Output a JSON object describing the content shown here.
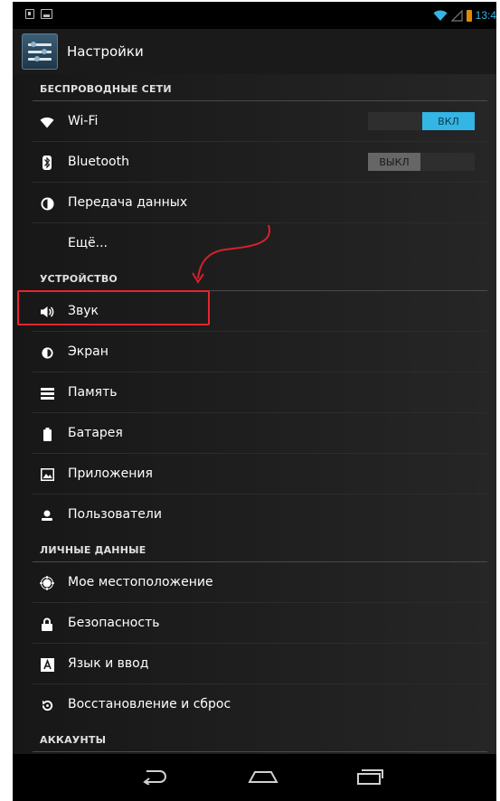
{
  "status_bar": {
    "time": "13:4",
    "icons": [
      "sim-card-icon",
      "image-icon",
      "wifi-signal-icon",
      "cell-signal-icon",
      "battery-icon"
    ],
    "time_color": "#33b5e5"
  },
  "action_bar": {
    "title": "Настройки",
    "icon": "settings-sliders-icon"
  },
  "sections": [
    {
      "header": "БЕСПРОВОДНЫЕ СЕТИ",
      "items": [
        {
          "label": "Wi-Fi",
          "icon": "wifi-icon",
          "toggle": "ВКЛ",
          "toggle_state": "on"
        },
        {
          "label": "Bluetooth",
          "icon": "bluetooth-icon",
          "toggle": "ВЫКЛ",
          "toggle_state": "off"
        },
        {
          "label": "Передача данных",
          "icon": "data-usage-icon"
        },
        {
          "label": "Ещё..."
        }
      ]
    },
    {
      "header": "УСТРОЙСТВО",
      "items": [
        {
          "label": "Звук",
          "icon": "speaker-icon",
          "highlighted": true
        },
        {
          "label": "Экран",
          "icon": "brightness-icon"
        },
        {
          "label": "Память",
          "icon": "storage-icon"
        },
        {
          "label": "Батарея",
          "icon": "battery-icon"
        },
        {
          "label": "Приложения",
          "icon": "apps-icon"
        },
        {
          "label": "Пользователи",
          "icon": "user-icon"
        }
      ]
    },
    {
      "header": "ЛИЧНЫЕ ДАННЫЕ",
      "items": [
        {
          "label": "Мое местоположение",
          "icon": "location-icon"
        },
        {
          "label": "Безопасность",
          "icon": "lock-icon"
        },
        {
          "label": "Язык и ввод",
          "icon": "language-icon"
        },
        {
          "label": "Восстановление и сброс",
          "icon": "restore-icon"
        }
      ]
    },
    {
      "header": "АККАУНТЫ",
      "items": []
    }
  ],
  "nav_bar": {
    "buttons": [
      "back-icon",
      "home-icon",
      "recent-apps-icon"
    ]
  },
  "colors": {
    "accent": "#33b5e5",
    "highlight_border": "#e8242f",
    "annotation_arrow": "#d9202a",
    "toggle_off": "#666666"
  }
}
